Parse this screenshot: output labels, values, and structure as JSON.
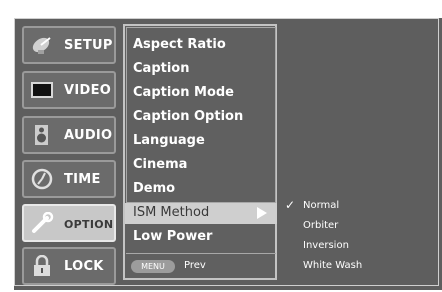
{
  "tabs": [
    {
      "label": "SETUP",
      "icon": "satellite-dish-icon",
      "selected": false
    },
    {
      "label": "VIDEO",
      "icon": "tv-screen-icon",
      "selected": false
    },
    {
      "label": "AUDIO",
      "icon": "speaker-icon",
      "selected": false
    },
    {
      "label": "TIME",
      "icon": "clock-icon",
      "selected": false
    },
    {
      "label": "OPTION",
      "icon": "wrench-icon",
      "selected": true
    },
    {
      "label": "LOCK",
      "icon": "padlock-icon",
      "selected": false
    }
  ],
  "menu": {
    "items": [
      "Aspect Ratio",
      "Caption",
      "Caption Mode",
      "Caption Option",
      "Language",
      "Cinema",
      "Demo"
    ],
    "highlighted": "ISM Method",
    "after": "Low Power",
    "menu_button": "MENU",
    "prev_label": "Prev"
  },
  "submenu": {
    "options": [
      "Normal",
      "Orbiter",
      "Inversion",
      "White Wash"
    ],
    "selected": "Normal"
  },
  "colors": {
    "background": "#5e5e5e",
    "highlight": "#cfcfcf",
    "text": "#ffffff"
  }
}
